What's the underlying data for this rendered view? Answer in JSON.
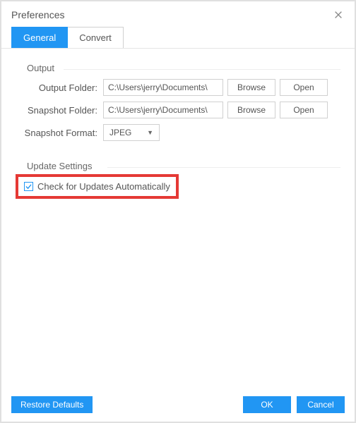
{
  "window": {
    "title": "Preferences"
  },
  "tabs": {
    "general": "General",
    "convert": "Convert"
  },
  "output": {
    "heading": "Output",
    "outputFolderLabel": "Output Folder:",
    "outputFolderValue": "C:\\Users\\jerry\\Documents\\",
    "snapshotFolderLabel": "Snapshot Folder:",
    "snapshotFolderValue": "C:\\Users\\jerry\\Documents\\",
    "snapshotFormatLabel": "Snapshot Format:",
    "snapshotFormatValue": "JPEG",
    "browseBtn": "Browse",
    "openBtn": "Open"
  },
  "update": {
    "heading": "Update Settings",
    "checkboxLabel": "Check for Updates Automatically",
    "checked": true
  },
  "footer": {
    "restore": "Restore Defaults",
    "ok": "OK",
    "cancel": "Cancel"
  }
}
